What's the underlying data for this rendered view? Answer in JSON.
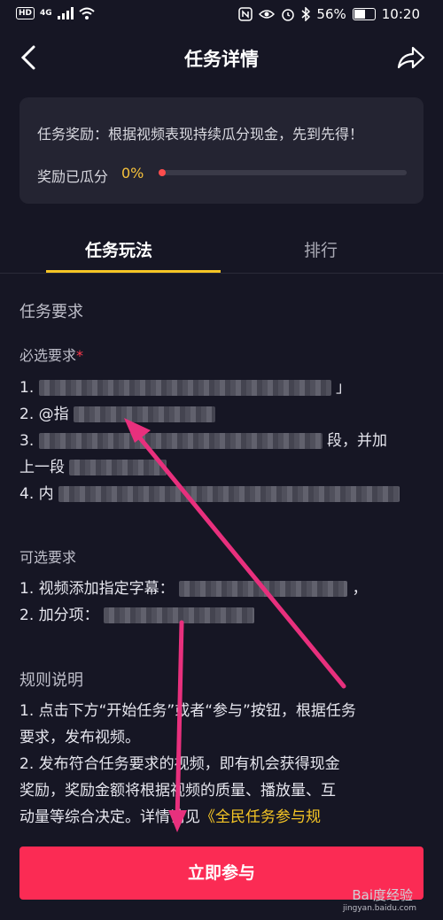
{
  "status_bar": {
    "hd": "HD",
    "net": "4G",
    "battery_text": "56%",
    "time": "10:20",
    "icons": [
      "signal-icon",
      "wifi-icon",
      "nfc-icon",
      "eye-icon",
      "alarm-icon",
      "bluetooth-icon",
      "battery-icon"
    ]
  },
  "header": {
    "title": "任务详情"
  },
  "reward": {
    "text": "任务奖励：根据视频表现持续瓜分现金，先到先得！",
    "progress_label": "奖励已瓜分",
    "progress_pct": "0%",
    "progress_value": 0,
    "accent_color": "#f7c23b",
    "dot_color": "#ff4d4d"
  },
  "tabs": [
    {
      "label": "任务玩法",
      "active": true
    },
    {
      "label": "排行",
      "active": false
    }
  ],
  "requirements": {
    "title": "任务要求",
    "required_title": "必选要求",
    "required_star": "*",
    "items": [
      {
        "prefix": "1.",
        "suffix": "」"
      },
      {
        "prefix": "2. @指",
        "suffix": ""
      },
      {
        "prefix": "3.",
        "suffix": "段，并加"
      },
      {
        "prefix": "上一段",
        "suffix": ""
      },
      {
        "prefix": "4. 内",
        "suffix": ""
      }
    ],
    "optional_title": "可选要求",
    "optional_items": [
      {
        "prefix": "1. 视频添加指定字幕：",
        "suffix": "，"
      },
      {
        "prefix": "2. 加分项：",
        "suffix": ""
      }
    ]
  },
  "rules": {
    "title": "规则说明",
    "lines": [
      "1. 点击下方“开始任务”或者“参与”按钮，根据任务",
      "要求，发布视频。",
      "2. 发布符合任务要求的视频，即有机会获得现金",
      "奖励，奖励金额将根据视频的质量、播放量、互",
      "动量等综合决定。详情请见"
    ],
    "link": "《全民任务参与规"
  },
  "cta": {
    "label": "立即参与",
    "color": "#fb2b54"
  },
  "watermark": {
    "brand": "Bai度经验",
    "url": "jingyan.baidu.com"
  }
}
